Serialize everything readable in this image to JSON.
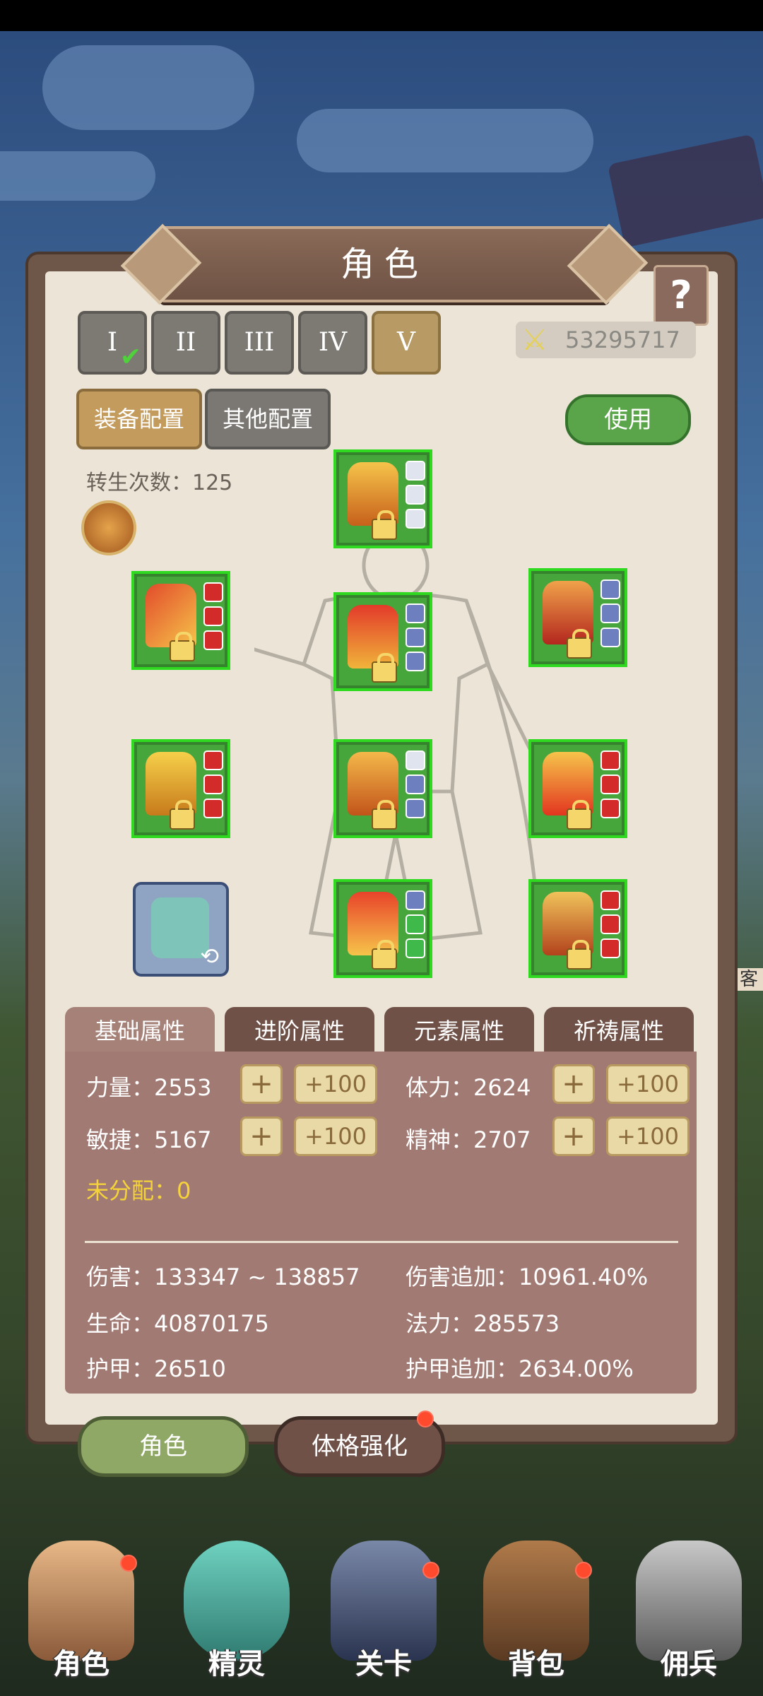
{
  "header": {
    "title": "角色",
    "help_label": "?"
  },
  "slots": [
    {
      "label": "I",
      "checked": true,
      "active": false
    },
    {
      "label": "II",
      "checked": false,
      "active": false
    },
    {
      "label": "III",
      "checked": false,
      "active": false
    },
    {
      "label": "IV",
      "checked": false,
      "active": false
    },
    {
      "label": "V",
      "checked": false,
      "active": true
    }
  ],
  "power": {
    "value": "53295717",
    "icon": "crossed-swords-icon"
  },
  "config_tabs": {
    "equip": "装备配置",
    "other": "其他配置",
    "use": "使用"
  },
  "rebirth": {
    "label": "转生次数：125"
  },
  "attribute_tabs": [
    "基础属性",
    "进阶属性",
    "元素属性",
    "祈祷属性"
  ],
  "stats": {
    "strength": "力量：2553",
    "stamina": "体力：2624",
    "agility": "敏捷：5167",
    "spirit": "精神：2707",
    "plus": "+",
    "plus100": "+100",
    "unassigned": "未分配：0"
  },
  "derived": {
    "damage": "伤害：133347 ~ 138857",
    "damage_bonus": "伤害追加：10961.40%",
    "life": "生命：40870175",
    "mana": "法力：285573",
    "armor": "护甲：26510",
    "armor_bonus": "护甲追加：2634.00%"
  },
  "bottom_tabs": {
    "character": "角色",
    "enhance": "体格强化"
  },
  "nav": [
    "角色",
    "精灵",
    "关卡",
    "背包",
    "佣兵"
  ],
  "side_npc": "客",
  "colors": {
    "panel": "#6e5648",
    "equip_bg": "#46a53b",
    "attr_bg": "#a17a73",
    "gold": "#c39b5d"
  }
}
